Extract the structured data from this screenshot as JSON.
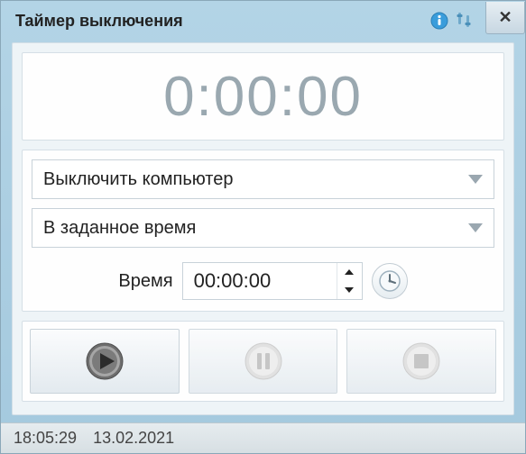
{
  "window": {
    "title": "Таймер выключения"
  },
  "timer": {
    "display": "0:00:00"
  },
  "controls": {
    "action_select": "Выключить компьютер",
    "mode_select": "В заданное время",
    "time_label": "Время",
    "time_value": "00:00:00"
  },
  "status": {
    "time": "18:05:29",
    "date": "13.02.2021"
  },
  "icons": {
    "info": "info",
    "settings": "settings",
    "close": "✕",
    "clock": "clock",
    "play": "play",
    "pause": "pause",
    "stop": "stop"
  }
}
